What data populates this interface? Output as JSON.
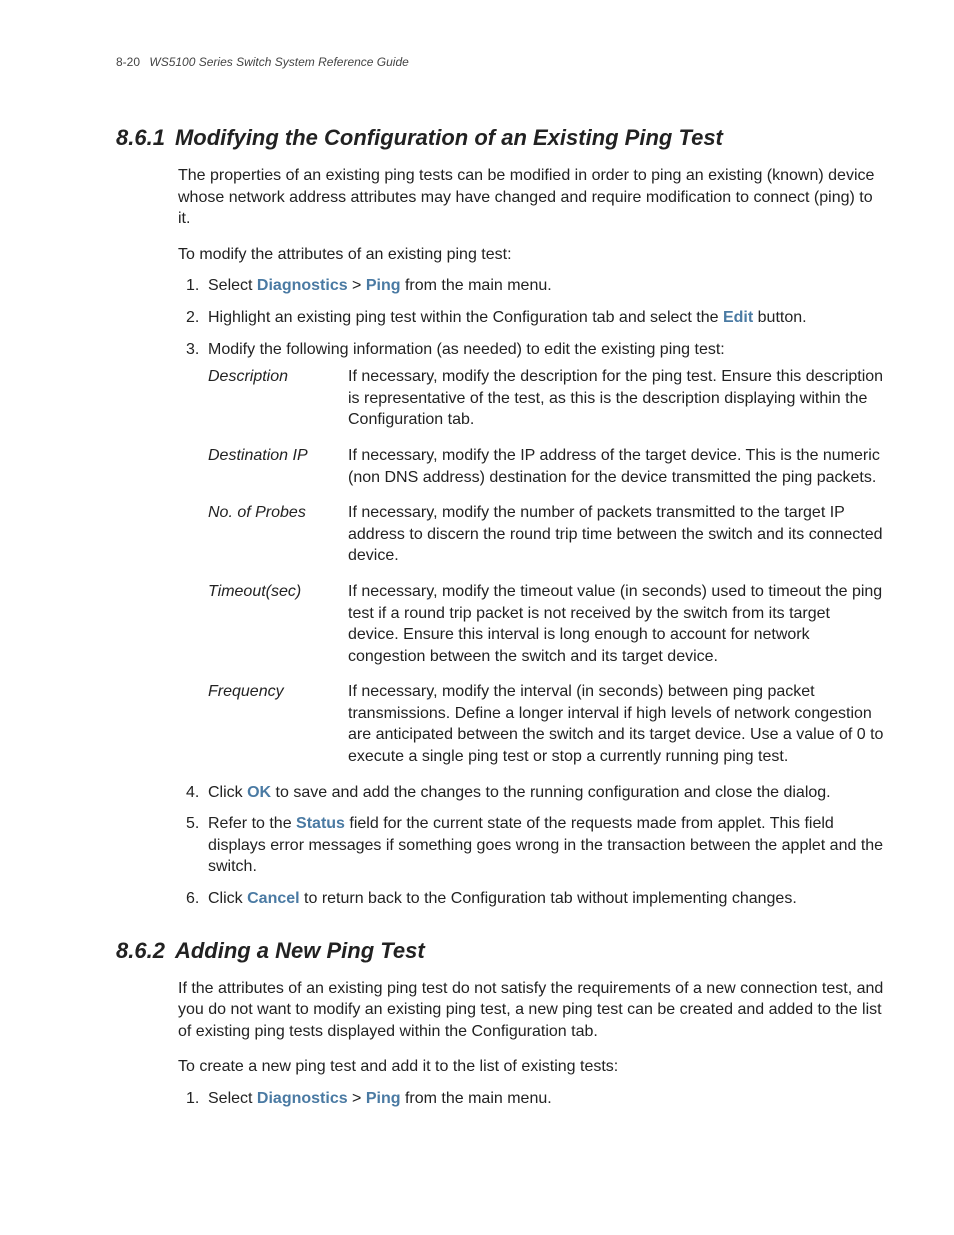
{
  "header": {
    "page_number": "8-20",
    "doc_title": "WS5100 Series Switch System Reference Guide"
  },
  "section1": {
    "number": "8.6.1",
    "title": "Modifying the Configuration of an Existing Ping Test",
    "intro": "The properties of an existing ping tests can be modified in order to ping an existing (known) device whose network address attributes may have changed and require modification to connect (ping) to it.",
    "lead_in": "To modify the attributes of an existing ping test:",
    "steps": {
      "s1": {
        "marker": "1.",
        "pre": "Select ",
        "kw1": "Diagnostics",
        "sep": " > ",
        "kw2": "Ping",
        "post": " from the main menu."
      },
      "s2": {
        "marker": "2.",
        "pre": "Highlight an existing ping test within the Configuration tab and select the ",
        "kw1": "Edit",
        "post": " button."
      },
      "s3": {
        "marker": "3.",
        "text": "Modify the following information (as needed) to edit the existing ping test:"
      },
      "defs": {
        "d1": {
          "term": "Description",
          "desc": "If necessary, modify the description for the ping test. Ensure this description is representative of the test, as this is the description displaying within the Configuration tab."
        },
        "d2": {
          "term": "Destination IP",
          "desc": "If necessary, modify the IP address of the target device. This is the numeric (non DNS address) destination for the device transmitted the ping packets."
        },
        "d3": {
          "term": "No. of Probes",
          "desc": "If necessary, modify the number of packets transmitted to the target IP address to discern the round trip time between the switch and its connected device."
        },
        "d4": {
          "term": "Timeout(sec)",
          "desc": "If necessary, modify the timeout value (in seconds) used to timeout the ping test if a round trip packet is not received by the switch from its target device. Ensure this interval is long enough to account for network congestion between the switch and its target device."
        },
        "d5": {
          "term": "Frequency",
          "desc": "If necessary, modify the interval (in seconds) between ping packet transmissions. Define a longer interval if high levels of network congestion are anticipated between the switch and its target device. Use a value of 0 to execute a single ping test or stop a currently running ping test."
        }
      },
      "s4": {
        "marker": "4.",
        "pre": "Click ",
        "kw1": "OK",
        "post": " to save and add the changes to the running configuration and close the dialog."
      },
      "s5": {
        "marker": "5.",
        "pre": "Refer to the ",
        "kw1": "Status",
        "post": " field for the current state of the requests made from applet. This field displays error messages if something goes wrong in the transaction between the applet and the switch."
      },
      "s6": {
        "marker": "6.",
        "pre": "Click ",
        "kw1": "Cancel",
        "post": " to return back to the Configuration tab without implementing changes."
      }
    }
  },
  "section2": {
    "number": "8.6.2",
    "title": "Adding a New Ping Test",
    "intro": "If the attributes of an existing ping test do not satisfy the requirements of a new connection test, and you do not want to modify an existing ping test, a new ping test can be created and added to the list of existing ping tests displayed within the Configuration tab.",
    "lead_in": "To create a new ping test and add it to the list of existing tests:",
    "steps": {
      "s1": {
        "marker": "1.",
        "pre": "Select ",
        "kw1": "Diagnostics",
        "sep": " > ",
        "kw2": "Ping",
        "post": " from the main menu."
      }
    }
  }
}
